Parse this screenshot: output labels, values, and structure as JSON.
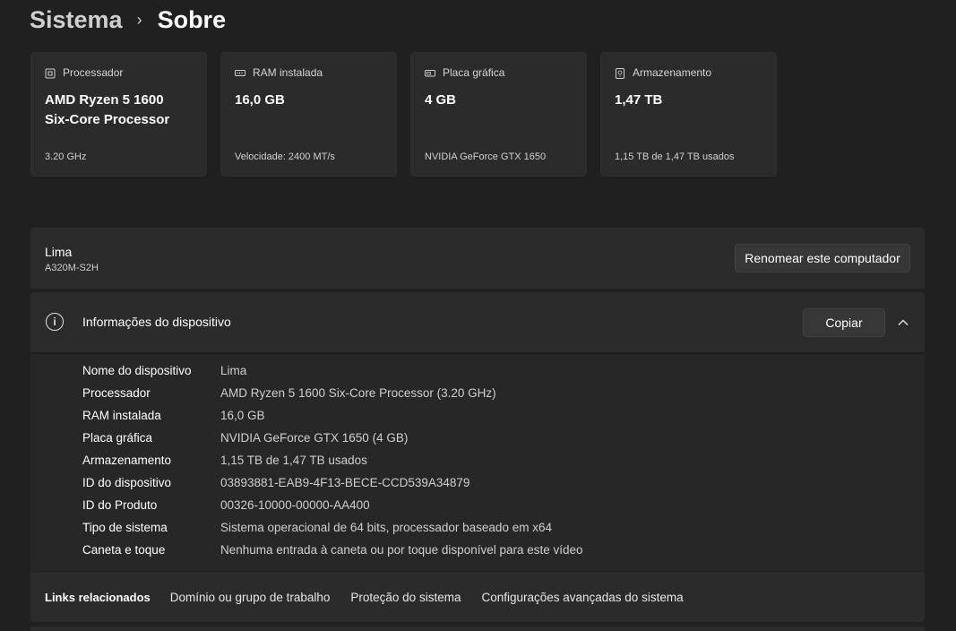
{
  "breadcrumb": {
    "parent": "Sistema",
    "separator": "›",
    "current": "Sobre"
  },
  "cards": [
    {
      "icon": "processor-icon",
      "label": "Processador",
      "value_line1": "AMD Ryzen 5 1600",
      "value_line2": "Six-Core Processor",
      "detail": "3.20 GHz"
    },
    {
      "icon": "ram-icon",
      "label": "RAM instalada",
      "value_line1": "16,0 GB",
      "value_line2": "",
      "detail": "Velocidade: 2400 MT/s"
    },
    {
      "icon": "gpu-icon",
      "label": "Placa gráfica",
      "value_line1": "4 GB",
      "value_line2": "",
      "detail": "NVIDIA GeForce GTX 1650"
    },
    {
      "icon": "storage-icon",
      "label": "Armazenamento",
      "value_line1": "1,47 TB",
      "value_line2": "",
      "detail": "1,15 TB de 1,47 TB usados"
    }
  ],
  "computer": {
    "name": "Lima",
    "model": "A320M-S2H",
    "rename_label": "Renomear este computador"
  },
  "device_info": {
    "title": "Informações do dispositivo",
    "copy_label": "Copiar",
    "rows": [
      {
        "key": "Nome do dispositivo",
        "value": "Lima"
      },
      {
        "key": "Processador",
        "value": "AMD Ryzen 5 1600 Six-Core Processor (3.20 GHz)"
      },
      {
        "key": "RAM instalada",
        "value": "16,0 GB"
      },
      {
        "key": "Placa gráfica",
        "value": "NVIDIA GeForce GTX 1650 (4 GB)"
      },
      {
        "key": "Armazenamento",
        "value": "1,15 TB de 1,47 TB usados"
      },
      {
        "key": "ID do dispositivo",
        "value": "03893881-EAB9-4F13-BECE-CCD539A34879"
      },
      {
        "key": "ID do Produto",
        "value": "00326-10000-00000-AA400"
      },
      {
        "key": "Tipo de sistema",
        "value": "Sistema operacional de 64 bits, processador baseado em x64"
      },
      {
        "key": "Caneta e toque",
        "value": "Nenhuma entrada à caneta ou por toque disponível para este vídeo"
      }
    ]
  },
  "related_links": {
    "title": "Links relacionados",
    "links": [
      "Domínio ou grupo de trabalho",
      "Proteção do sistema",
      "Configurações avançadas do sistema"
    ]
  }
}
